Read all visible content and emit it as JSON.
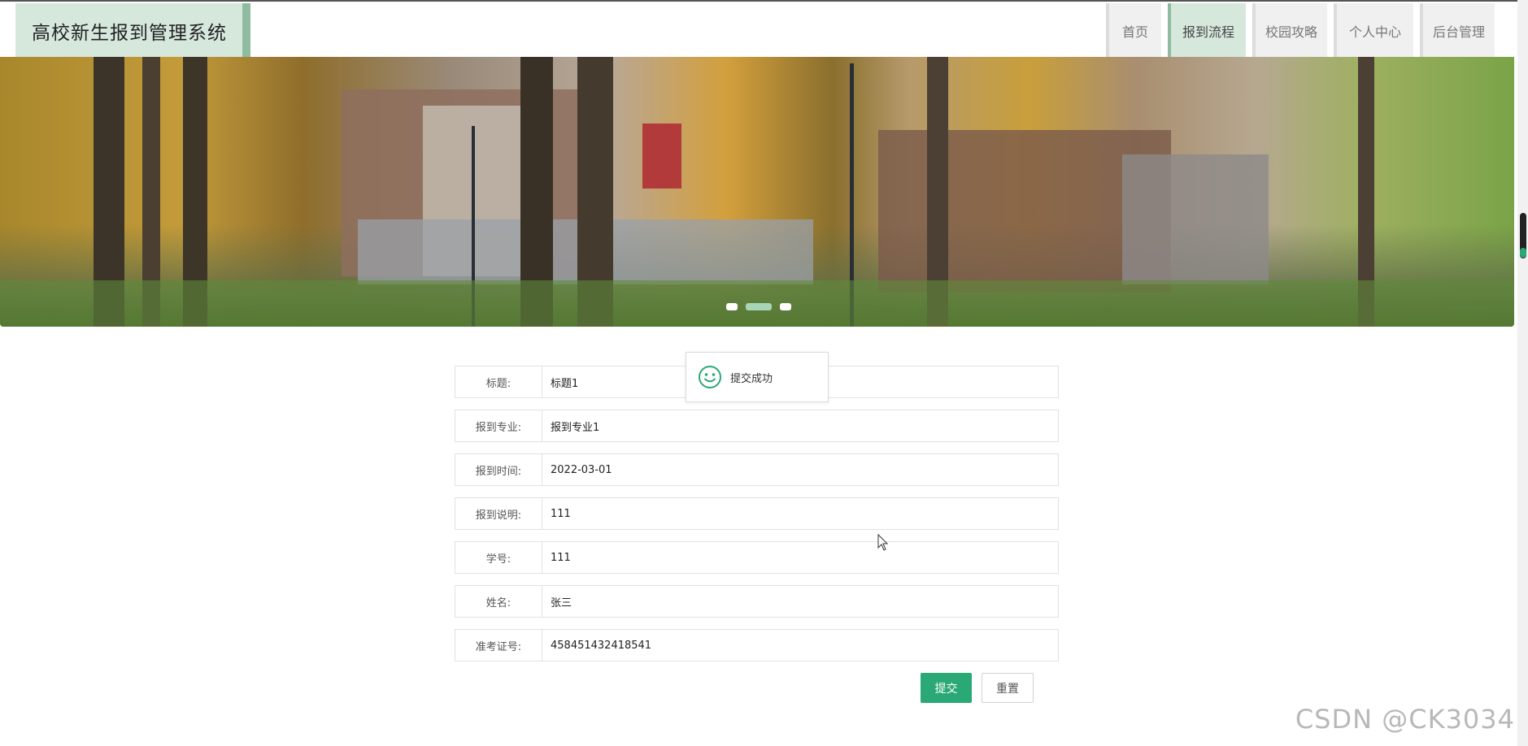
{
  "app": {
    "title": "高校新生报到管理系统"
  },
  "nav": {
    "items": [
      {
        "label": "首页",
        "active": false
      },
      {
        "label": "报到流程",
        "active": true
      },
      {
        "label": "校园攻略",
        "active": false
      },
      {
        "label": "个人中心",
        "active": false
      },
      {
        "label": "后台管理",
        "active": false
      }
    ]
  },
  "banner": {
    "slides": 3,
    "active_slide": 2
  },
  "toast": {
    "icon": "smile-icon",
    "message": "提交成功"
  },
  "form": {
    "fields": [
      {
        "label": "标题:",
        "value": "标题1"
      },
      {
        "label": "报到专业:",
        "value": "报到专业1"
      },
      {
        "label": "报到时间:",
        "value": "2022-03-01"
      },
      {
        "label": "报到说明:",
        "value": "111"
      },
      {
        "label": "学号:",
        "value": "111"
      },
      {
        "label": "姓名:",
        "value": "张三"
      },
      {
        "label": "准考证号:",
        "value": "458451432418541"
      }
    ],
    "submit_label": "提交",
    "reset_label": "重置"
  },
  "watermark": "CSDN @CK3034",
  "colors": {
    "accent": "#2aa876",
    "nav_active": "#d6e8dc",
    "nav_border": "#8fbca1"
  }
}
